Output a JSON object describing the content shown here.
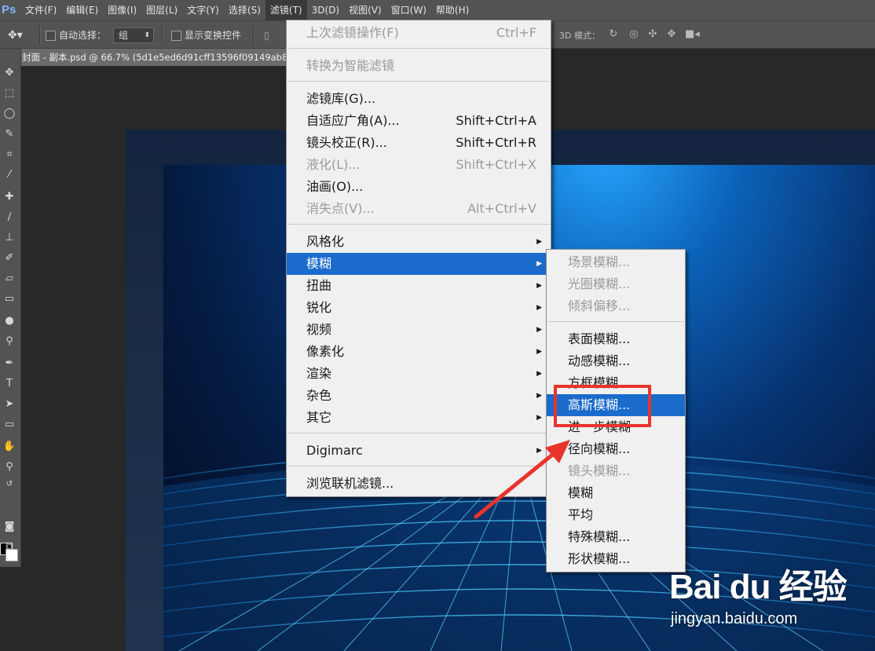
{
  "app": {
    "logo": "Ps"
  },
  "menubar": {
    "items": [
      "文件(F)",
      "编辑(E)",
      "图像(I)",
      "图层(L)",
      "文字(Y)",
      "选择(S)",
      "滤镜(T)",
      "3D(D)",
      "视图(V)",
      "窗口(W)",
      "帮助(H)"
    ],
    "active": "滤镜(T)"
  },
  "options_bar": {
    "auto_select_label": "自动选择：",
    "auto_select_value": "组",
    "show_transform_label": "显示变换控件",
    "mode_3d_label": "3D 模式："
  },
  "document_tab": {
    "title": "封面 - 副本.psd @ 66.7% (5d1e5ed6d91cff13596f09149ab828"
  },
  "filter_menu": {
    "last_filter": {
      "label": "上次滤镜操作(F)",
      "shortcut": "Ctrl+F",
      "enabled": false
    },
    "convert_smart": {
      "label": "转换为智能滤镜",
      "enabled": false
    },
    "gallery": {
      "label": "滤镜库(G)..."
    },
    "adaptive_wide": {
      "label": "自适应广角(A)...",
      "shortcut": "Shift+Ctrl+A"
    },
    "lens_correction": {
      "label": "镜头校正(R)...",
      "shortcut": "Shift+Ctrl+R"
    },
    "liquify": {
      "label": "液化(L)...",
      "shortcut": "Shift+Ctrl+X",
      "enabled": false
    },
    "oil_paint": {
      "label": "油画(O)..."
    },
    "vanishing_point": {
      "label": "消失点(V)...",
      "shortcut": "Alt+Ctrl+V",
      "enabled": false
    },
    "submenus": [
      "风格化",
      "模糊",
      "扭曲",
      "锐化",
      "视频",
      "像素化",
      "渲染",
      "杂色",
      "其它"
    ],
    "selected_submenu": "模糊",
    "digimarc": "Digimarc",
    "browse_online": "浏览联机滤镜..."
  },
  "blur_submenu": {
    "group1": [
      "场景模糊...",
      "光圈模糊...",
      "倾斜偏移..."
    ],
    "group2": [
      "表面模糊...",
      "动感模糊...",
      "方框模糊...",
      "高斯模糊...",
      "进一步模糊",
      "径向模糊...",
      "镜头模糊...",
      "模糊",
      "平均",
      "特殊模糊...",
      "形状模糊..."
    ],
    "disabled": [
      "场景模糊...",
      "光圈模糊...",
      "倾斜偏移...",
      "镜头模糊..."
    ],
    "selected": "高斯模糊..."
  },
  "watermark": {
    "brand": "Bai du 经验",
    "url": "jingyan.baidu.com"
  },
  "colors": {
    "menu_highlight": "#1a6bcc",
    "annotation_red": "#e8342c",
    "ui_dark": "#535353"
  }
}
